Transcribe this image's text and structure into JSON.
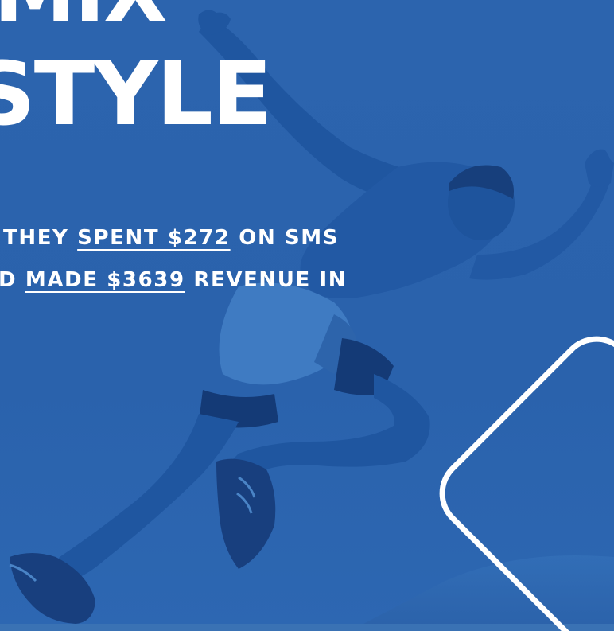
{
  "headline": {
    "line1": "MIX",
    "line2": "STYLE"
  },
  "body": {
    "line1": {
      "prefix": "THEY ",
      "highlight": "SPENT $272",
      "suffix": " ON SMS"
    },
    "line2": {
      "prefix": "D ",
      "highlight": "MADE $3639",
      "suffix": " REVENUE IN"
    }
  },
  "image": {
    "subject": "sprinter in starting lunge, duotone blue"
  },
  "colors": {
    "background": "#2a63ad",
    "text": "#ffffff",
    "accent_outline": "#ffffff"
  }
}
